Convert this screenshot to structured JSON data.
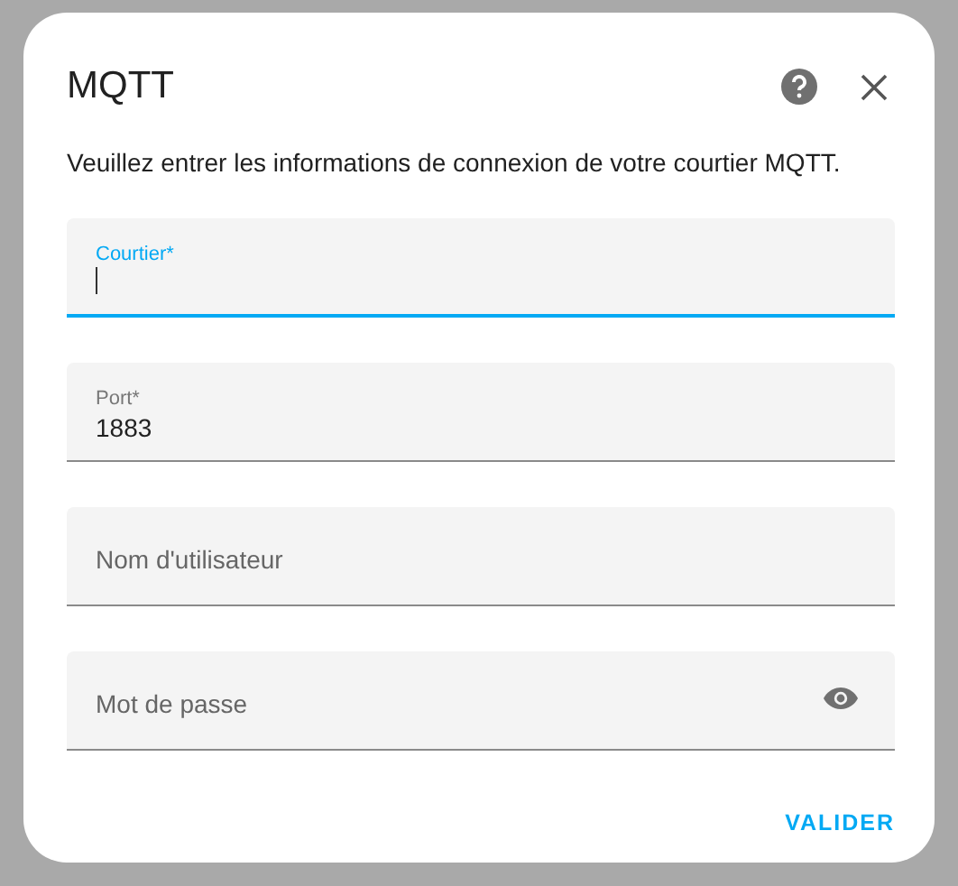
{
  "dialog": {
    "title": "MQTT",
    "description": "Veuillez entrer les informations de connexion de votre courtier MQTT."
  },
  "fields": [
    {
      "kind": "text",
      "label": "Courtier*",
      "focused": true
    },
    {
      "kind": "text",
      "label": "Port*",
      "value": "1883",
      "focused": false
    },
    {
      "kind": "text",
      "label": "Nom d'utilisateur",
      "focused": false
    },
    {
      "kind": "password",
      "label": "Mot de passe",
      "focused": false
    }
  ],
  "buttons": [
    "VALIDER"
  ]
}
